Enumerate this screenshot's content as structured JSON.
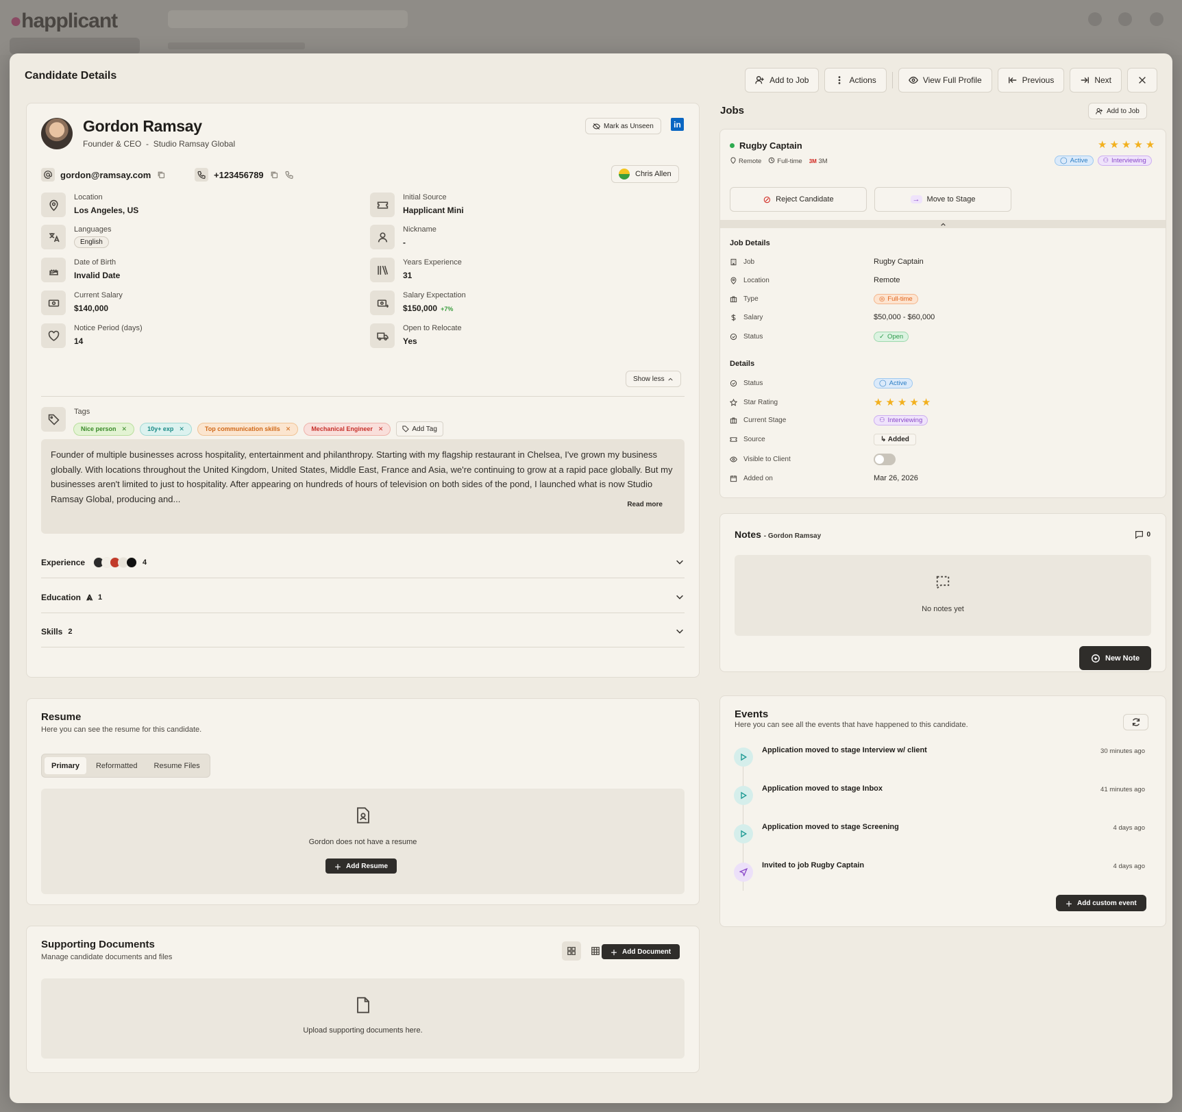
{
  "background": {
    "logo": "happlicant"
  },
  "modal": {
    "title": "Candidate Details",
    "buttons": {
      "add_to_job": "Add to Job",
      "actions": "Actions",
      "view_full_profile": "View Full Profile",
      "previous": "Previous",
      "next": "Next"
    }
  },
  "candidate": {
    "name": "Gordon Ramsay",
    "title": "Founder & CEO",
    "company": "Studio Ramsay Global",
    "mark_unseen": "Mark as Unseen",
    "linkedin": "in",
    "email": "gordon@ramsay.com",
    "phone": "+123456789",
    "owner": "Chris Allen",
    "fields_left": [
      {
        "icon": "location-pin-icon",
        "label": "Location",
        "value": "Los Angeles, US"
      },
      {
        "icon": "translate-icon",
        "label": "Languages",
        "value": "English"
      },
      {
        "icon": "cake-icon",
        "label": "Date of Birth",
        "value": "Invalid Date"
      },
      {
        "icon": "money-icon",
        "label": "Current Salary",
        "value": "$140,000"
      },
      {
        "icon": "heart-icon",
        "label": "Notice Period (days)",
        "value": "14"
      }
    ],
    "fields_right": [
      {
        "icon": "ticket-icon",
        "label": "Initial Source",
        "value": "Happlicant Mini"
      },
      {
        "icon": "person-icon",
        "label": "Nickname",
        "value": "-"
      },
      {
        "icon": "books-icon",
        "label": "Years Experience",
        "value": "31"
      },
      {
        "icon": "money-plus-icon",
        "label": "Salary Expectation",
        "value": "$150,000",
        "delta": "+7%"
      },
      {
        "icon": "truck-icon",
        "label": "Open to Relocate",
        "value": "Yes"
      }
    ],
    "show_less": "Show less",
    "tags_label": "Tags",
    "tags": [
      "Nice person",
      "10y+ exp",
      "Top communication skills",
      "Mechanical Engineer"
    ],
    "add_tag": "Add Tag",
    "bio": "Founder of multiple businesses across hospitality, entertainment and philanthropy. Starting with my flagship restaurant in Chelsea, I've grown my business globally. With locations throughout the United Kingdom, United States, Middle East, France and Asia, we're continuing to grow at a rapid pace globally. But my businesses aren't limited to just to hospitality. After appearing on hundreds of hours of television on both sides of the pond, I launched what is now Studio Ramsay Global, producing and...",
    "read_more": "Read more",
    "sections": [
      {
        "label": "Experience",
        "count": "4"
      },
      {
        "label": "Education",
        "count": "1"
      },
      {
        "label": "Skills",
        "count": "2"
      }
    ]
  },
  "resume": {
    "title": "Resume",
    "subtitle": "Here you can see the resume for this candidate.",
    "tabs": [
      "Primary",
      "Reformatted",
      "Resume Files"
    ],
    "empty_message": "Gordon does not have a resume",
    "add_button": "Add Resume"
  },
  "documents": {
    "title": "Supporting Documents",
    "subtitle": "Manage candidate documents and files",
    "add_button": "Add Document",
    "empty_message": "Upload supporting documents here."
  },
  "jobs": {
    "title": "Jobs",
    "add_button": "Add to Job",
    "job": {
      "title": "Rugby Captain",
      "location": "Remote",
      "type": "Full-time",
      "company_logo": "3M",
      "company": "3M",
      "rating": 5,
      "status": "Active",
      "stage": "Interviewing",
      "reject": "Reject Candidate",
      "move": "Move to Stage"
    },
    "job_details_title": "Job Details",
    "job_details": [
      {
        "icon": "building-icon",
        "label": "Job",
        "value": "Rugby Captain"
      },
      {
        "icon": "location-pin-icon",
        "label": "Location",
        "value": "Remote"
      },
      {
        "icon": "briefcase-icon",
        "label": "Type",
        "value": "Full-time"
      },
      {
        "icon": "dollar-icon",
        "label": "Salary",
        "value": "$50,000 - $60,000"
      },
      {
        "icon": "check-circle-icon",
        "label": "Status",
        "value": "Open"
      }
    ],
    "details_title": "Details",
    "details": [
      {
        "icon": "check-circle-icon",
        "label": "Status",
        "value": "Active"
      },
      {
        "icon": "star-icon",
        "label": "Star Rating",
        "value": "5"
      },
      {
        "icon": "briefcase-icon",
        "label": "Current Stage",
        "value": "Interviewing"
      },
      {
        "icon": "ticket-icon",
        "label": "Source",
        "value": "Added"
      },
      {
        "icon": "eye-icon",
        "label": "Visible to Client",
        "value": ""
      },
      {
        "icon": "calendar-icon",
        "label": "Added on",
        "value": "Mar 26, 2026"
      }
    ]
  },
  "notes": {
    "title": "Notes",
    "subject": "- Gordon Ramsay",
    "count": "0",
    "empty_message": "No notes yet",
    "new_button": "New Note"
  },
  "events": {
    "title": "Events",
    "subtitle": "Here you can see all the events that have happened to this candidate.",
    "items": [
      {
        "icon": "play",
        "text": "Application moved to stage Interview w/ client",
        "time": "30 minutes ago"
      },
      {
        "icon": "play",
        "text": "Application moved to stage Inbox",
        "time": "41 minutes ago"
      },
      {
        "icon": "play",
        "text": "Application moved to stage Screening",
        "time": "4 days ago"
      },
      {
        "icon": "send",
        "text": "Invited to job Rugby Captain",
        "time": "4 days ago"
      }
    ],
    "add_button": "Add custom event"
  }
}
